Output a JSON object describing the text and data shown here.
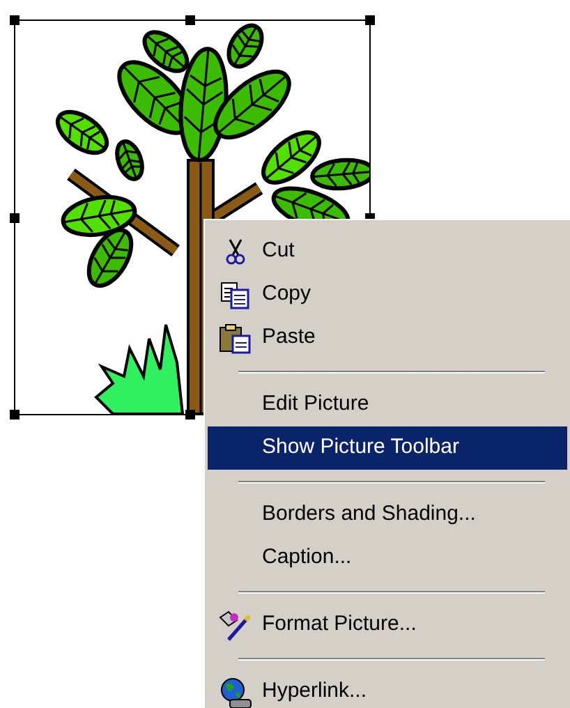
{
  "context_menu": {
    "items": [
      {
        "kind": "item",
        "label": "Cut",
        "selected": false
      },
      {
        "kind": "item",
        "label": "Copy",
        "selected": false
      },
      {
        "kind": "item",
        "label": "Paste",
        "selected": false
      },
      {
        "kind": "separator"
      },
      {
        "kind": "item",
        "label": "Edit Picture",
        "selected": false
      },
      {
        "kind": "item",
        "label": "Show Picture Toolbar",
        "selected": true
      },
      {
        "kind": "separator"
      },
      {
        "kind": "item",
        "label": "Borders and Shading...",
        "selected": false
      },
      {
        "kind": "item",
        "label": "Caption...",
        "selected": false
      },
      {
        "kind": "separator"
      },
      {
        "kind": "item",
        "label": "Format Picture...",
        "selected": false
      },
      {
        "kind": "separator"
      },
      {
        "kind": "item",
        "label": "Hyperlink...",
        "selected": false
      }
    ]
  }
}
